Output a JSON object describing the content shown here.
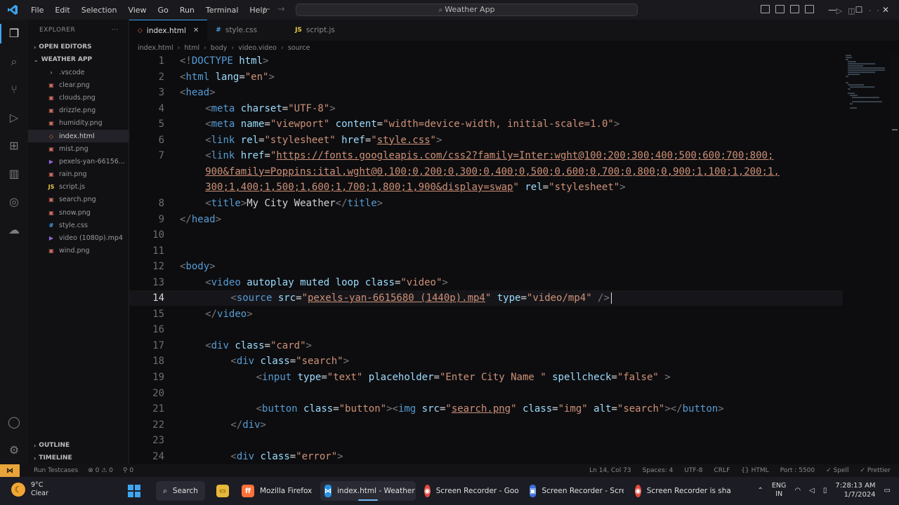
{
  "window": {
    "title": "Weather App",
    "menu": [
      "File",
      "Edit",
      "Selection",
      "View",
      "Go",
      "Run",
      "Terminal",
      "Help"
    ]
  },
  "sidebar": {
    "header": "EXPLORER",
    "open_editors": "OPEN EDITORS",
    "project": "WEATHER APP",
    "files": [
      {
        "name": ".vscode",
        "icon": "folder-icon"
      },
      {
        "name": "clear.png",
        "icon": "image-file-icon"
      },
      {
        "name": "clouds.png",
        "icon": "image-file-icon"
      },
      {
        "name": "drizzle.png",
        "icon": "image-file-icon"
      },
      {
        "name": "humidity.png",
        "icon": "image-file-icon"
      },
      {
        "name": "index.html",
        "icon": "html-file-icon",
        "selected": true
      },
      {
        "name": "mist.png",
        "icon": "image-file-icon"
      },
      {
        "name": "pexels-yan-66156...",
        "icon": "video-file-icon"
      },
      {
        "name": "rain.png",
        "icon": "image-file-icon"
      },
      {
        "name": "script.js",
        "icon": "js-file-icon"
      },
      {
        "name": "search.png",
        "icon": "image-file-icon"
      },
      {
        "name": "snow.png",
        "icon": "image-file-icon"
      },
      {
        "name": "style.css",
        "icon": "css-file-icon"
      },
      {
        "name": "video (1080p).mp4",
        "icon": "video-file-icon"
      },
      {
        "name": "wind.png",
        "icon": "image-file-icon"
      }
    ],
    "outline": "OUTLINE",
    "timeline": "TIMELINE"
  },
  "tabs": [
    {
      "label": "index.html",
      "active": true
    },
    {
      "label": "style.css",
      "active": false
    },
    {
      "label": "script.js",
      "active": false
    }
  ],
  "breadcrumb": [
    "index.html",
    "html",
    "body",
    "video.video",
    "source"
  ],
  "editor": {
    "current_line": 14,
    "lines": [
      {
        "n": "1",
        "i": 0,
        "t": [
          [
            "p",
            "<!"
          ],
          [
            "g",
            "DOCTYPE"
          ],
          [
            "a",
            " html"
          ],
          [
            "p",
            ">"
          ]
        ]
      },
      {
        "n": "2",
        "i": 0,
        "t": [
          [
            "p",
            "<"
          ],
          [
            "g",
            "html"
          ],
          [
            "a",
            " lang"
          ],
          [
            "x",
            "="
          ],
          [
            "s",
            "\"en\""
          ],
          [
            "p",
            ">"
          ]
        ]
      },
      {
        "n": "3",
        "i": 0,
        "t": [
          [
            "p",
            "<"
          ],
          [
            "g",
            "head"
          ],
          [
            "p",
            ">"
          ]
        ]
      },
      {
        "n": "4",
        "i": 1,
        "t": [
          [
            "p",
            "<"
          ],
          [
            "g",
            "meta"
          ],
          [
            "a",
            " charset"
          ],
          [
            "x",
            "="
          ],
          [
            "s",
            "\"UTF-8\""
          ],
          [
            "p",
            ">"
          ]
        ]
      },
      {
        "n": "5",
        "i": 1,
        "t": [
          [
            "p",
            "<"
          ],
          [
            "g",
            "meta"
          ],
          [
            "a",
            " name"
          ],
          [
            "x",
            "="
          ],
          [
            "s",
            "\"viewport\""
          ],
          [
            "a",
            " content"
          ],
          [
            "x",
            "="
          ],
          [
            "s",
            "\"width=device-width, initial-scale=1.0\""
          ],
          [
            "p",
            ">"
          ]
        ]
      },
      {
        "n": "6",
        "i": 1,
        "t": [
          [
            "p",
            "<"
          ],
          [
            "g",
            "link"
          ],
          [
            "a",
            " rel"
          ],
          [
            "x",
            "="
          ],
          [
            "s",
            "\"stylesheet\""
          ],
          [
            "a",
            " href"
          ],
          [
            "x",
            "="
          ],
          [
            "s",
            "\""
          ],
          [
            "l",
            "style.css"
          ],
          [
            "s",
            "\""
          ],
          [
            "p",
            ">"
          ]
        ]
      },
      {
        "n": "7",
        "i": 1,
        "t": [
          [
            "p",
            "<"
          ],
          [
            "g",
            "link"
          ],
          [
            "a",
            " href"
          ],
          [
            "x",
            "="
          ],
          [
            "s",
            "\""
          ],
          [
            "l",
            "https://fonts.googleapis.com/css2?family=Inter:wght@100;200;300;400;500;600;700;800;"
          ]
        ]
      },
      {
        "n": "",
        "i": 1,
        "t": [
          [
            "l",
            "900&family=Poppins:ital,wght@0,100;0,200;0,300;0,400;0,500;0,600;0,700;0,800;0,900;1,100;1,200;1,"
          ]
        ]
      },
      {
        "n": "",
        "i": 1,
        "t": [
          [
            "l",
            "300;1,400;1,500;1,600;1,700;1,800;1,900&display=swap"
          ],
          [
            "s",
            "\""
          ],
          [
            "a",
            " rel"
          ],
          [
            "x",
            "="
          ],
          [
            "s",
            "\"stylesheet\""
          ],
          [
            "p",
            ">"
          ]
        ]
      },
      {
        "n": "8",
        "i": 1,
        "t": [
          [
            "p",
            "<"
          ],
          [
            "g",
            "title"
          ],
          [
            "p",
            ">"
          ],
          [
            "x",
            "My City Weather"
          ],
          [
            "p",
            "</"
          ],
          [
            "g",
            "title"
          ],
          [
            "p",
            ">"
          ]
        ]
      },
      {
        "n": "9",
        "i": 0,
        "t": [
          [
            "p",
            "</"
          ],
          [
            "g",
            "head"
          ],
          [
            "p",
            ">"
          ]
        ]
      },
      {
        "n": "10",
        "i": 0,
        "t": []
      },
      {
        "n": "11",
        "i": 0,
        "t": []
      },
      {
        "n": "12",
        "i": 0,
        "t": [
          [
            "p",
            "<"
          ],
          [
            "g",
            "body"
          ],
          [
            "p",
            ">"
          ]
        ]
      },
      {
        "n": "13",
        "i": 1,
        "t": [
          [
            "p",
            "<"
          ],
          [
            "g",
            "video"
          ],
          [
            "a",
            " autoplay muted loop class"
          ],
          [
            "x",
            "="
          ],
          [
            "s",
            "\"video\""
          ],
          [
            "p",
            ">"
          ]
        ]
      },
      {
        "n": "14",
        "i": 2,
        "t": [
          [
            "p",
            "<"
          ],
          [
            "g",
            "source"
          ],
          [
            "a",
            " src"
          ],
          [
            "x",
            "="
          ],
          [
            "s",
            "\""
          ],
          [
            "l",
            "pexels-yan-6615680 (1440p).mp4"
          ],
          [
            "s",
            "\""
          ],
          [
            "a",
            " type"
          ],
          [
            "x",
            "="
          ],
          [
            "s",
            "\"video/mp4\""
          ],
          [
            "p",
            " />"
          ]
        ]
      },
      {
        "n": "15",
        "i": 1,
        "t": [
          [
            "p",
            "</"
          ],
          [
            "g",
            "video"
          ],
          [
            "p",
            ">"
          ]
        ]
      },
      {
        "n": "16",
        "i": 0,
        "t": []
      },
      {
        "n": "17",
        "i": 1,
        "t": [
          [
            "p",
            "<"
          ],
          [
            "g",
            "div"
          ],
          [
            "a",
            " class"
          ],
          [
            "x",
            "="
          ],
          [
            "s",
            "\"card\""
          ],
          [
            "p",
            ">"
          ]
        ]
      },
      {
        "n": "18",
        "i": 2,
        "t": [
          [
            "p",
            "<"
          ],
          [
            "g",
            "div"
          ],
          [
            "a",
            " class"
          ],
          [
            "x",
            "="
          ],
          [
            "s",
            "\"search\""
          ],
          [
            "p",
            ">"
          ]
        ]
      },
      {
        "n": "19",
        "i": 3,
        "t": [
          [
            "p",
            "<"
          ],
          [
            "g",
            "input"
          ],
          [
            "a",
            " type"
          ],
          [
            "x",
            "="
          ],
          [
            "s",
            "\"text\""
          ],
          [
            "a",
            " placeholder"
          ],
          [
            "x",
            "="
          ],
          [
            "s",
            "\"Enter City Name \""
          ],
          [
            "a",
            " spellcheck"
          ],
          [
            "x",
            "="
          ],
          [
            "s",
            "\"false\""
          ],
          [
            "p",
            " >"
          ]
        ]
      },
      {
        "n": "20",
        "i": 0,
        "t": []
      },
      {
        "n": "21",
        "i": 3,
        "t": [
          [
            "p",
            "<"
          ],
          [
            "g",
            "button"
          ],
          [
            "a",
            " class"
          ],
          [
            "x",
            "="
          ],
          [
            "s",
            "\"button\""
          ],
          [
            "p",
            ">"
          ],
          [
            "p",
            "<"
          ],
          [
            "g",
            "img"
          ],
          [
            "a",
            " src"
          ],
          [
            "x",
            "="
          ],
          [
            "s",
            "\""
          ],
          [
            "l",
            "search.png"
          ],
          [
            "s",
            "\""
          ],
          [
            "a",
            " class"
          ],
          [
            "x",
            "="
          ],
          [
            "s",
            "\"img\""
          ],
          [
            "a",
            " alt"
          ],
          [
            "x",
            "="
          ],
          [
            "s",
            "\"search\""
          ],
          [
            "p",
            ">"
          ],
          [
            "p",
            "</"
          ],
          [
            "g",
            "button"
          ],
          [
            "p",
            ">"
          ]
        ]
      },
      {
        "n": "22",
        "i": 2,
        "t": [
          [
            "p",
            "</"
          ],
          [
            "g",
            "div"
          ],
          [
            "p",
            ">"
          ]
        ]
      },
      {
        "n": "23",
        "i": 0,
        "t": []
      },
      {
        "n": "24",
        "i": 2,
        "t": [
          [
            "p",
            "<"
          ],
          [
            "g",
            "div"
          ],
          [
            "a",
            " class"
          ],
          [
            "x",
            "="
          ],
          [
            "s",
            "\"error\""
          ],
          [
            "p",
            ">"
          ]
        ]
      }
    ]
  },
  "statusbar": {
    "left": [
      "Run Testcases",
      "⊗ 0 ⚠ 0",
      "⚲ 0"
    ],
    "right": [
      "Ln 14, Col 73",
      "Spaces: 4",
      "UTF-8",
      "CRLF",
      "{} HTML",
      "Port : 5500",
      "✓ Spell",
      "✓ Prettier"
    ]
  },
  "taskbar": {
    "weather_temp": "9°C",
    "weather_cond": "Clear",
    "search": "Search",
    "apps": [
      {
        "label": "Mozilla Firefox",
        "icon": "firefox-icon",
        "color": "#ff7139"
      },
      {
        "label": "index.html - Weather Ap",
        "icon": "vscode-icon",
        "color": "#2a8fe0",
        "active": true
      },
      {
        "label": "Screen Recorder - Goog",
        "icon": "chrome-icon",
        "color": "#e04a3a"
      },
      {
        "label": "Screen Recorder - Scre",
        "icon": "screen-recorder-icon",
        "color": "#3b6fd8"
      },
      {
        "label": "Screen Recorder is shari",
        "icon": "chrome-icon",
        "color": "#e04a3a"
      }
    ],
    "lang_top": "ENG",
    "lang_bottom": "IN",
    "time": "7:28:13 AM",
    "date": "1/7/2024"
  },
  "colors": {
    "accent": "#3ea6f0",
    "remote": "#e8a43a"
  }
}
